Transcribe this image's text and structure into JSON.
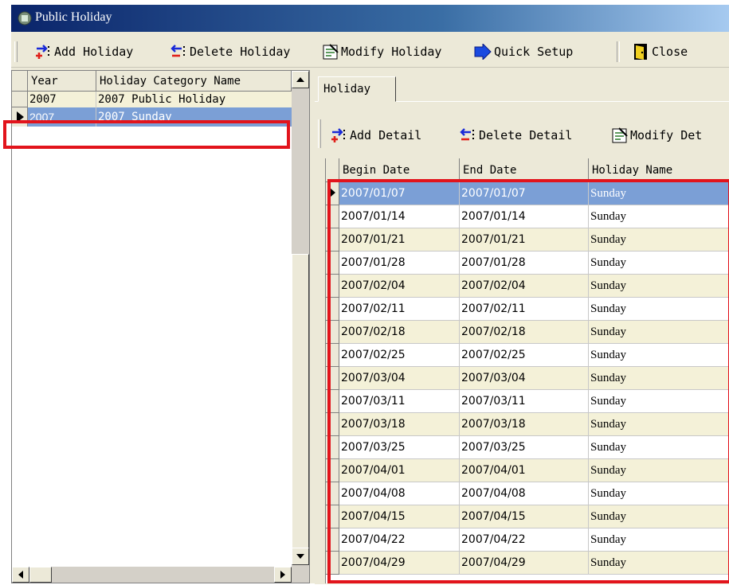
{
  "window": {
    "title": "Public Holiday",
    "icon": "app-icon"
  },
  "toolbar": {
    "add": "Add Holiday",
    "delete": "Delete Holiday",
    "modify": "Modify Holiday",
    "quick": "Quick Setup",
    "close": "Close"
  },
  "left_grid": {
    "headers": {
      "year": "Year",
      "category": "Holiday Category Name"
    },
    "rows": [
      {
        "year": "2007",
        "category": "2007 Public Holiday",
        "selected": false
      },
      {
        "year": "2007",
        "category": "2007 Sunday",
        "selected": true
      }
    ]
  },
  "tab": {
    "label": "Holiday"
  },
  "detail_toolbar": {
    "add": "Add Detail",
    "delete": "Delete Detail",
    "modify": "Modify Det"
  },
  "detail_grid": {
    "headers": {
      "begin": "Begin Date",
      "end": "End Date",
      "name": "Holiday Name"
    },
    "rows": [
      {
        "begin": "2007/01/07",
        "end": "2007/01/07",
        "name": "Sunday"
      },
      {
        "begin": "2007/01/14",
        "end": "2007/01/14",
        "name": "Sunday"
      },
      {
        "begin": "2007/01/21",
        "end": "2007/01/21",
        "name": "Sunday"
      },
      {
        "begin": "2007/01/28",
        "end": "2007/01/28",
        "name": "Sunday"
      },
      {
        "begin": "2007/02/04",
        "end": "2007/02/04",
        "name": "Sunday"
      },
      {
        "begin": "2007/02/11",
        "end": "2007/02/11",
        "name": "Sunday"
      },
      {
        "begin": "2007/02/18",
        "end": "2007/02/18",
        "name": "Sunday"
      },
      {
        "begin": "2007/02/25",
        "end": "2007/02/25",
        "name": "Sunday"
      },
      {
        "begin": "2007/03/04",
        "end": "2007/03/04",
        "name": "Sunday"
      },
      {
        "begin": "2007/03/11",
        "end": "2007/03/11",
        "name": "Sunday"
      },
      {
        "begin": "2007/03/18",
        "end": "2007/03/18",
        "name": "Sunday"
      },
      {
        "begin": "2007/03/25",
        "end": "2007/03/25",
        "name": "Sunday"
      },
      {
        "begin": "2007/04/01",
        "end": "2007/04/01",
        "name": "Sunday"
      },
      {
        "begin": "2007/04/08",
        "end": "2007/04/08",
        "name": "Sunday"
      },
      {
        "begin": "2007/04/15",
        "end": "2007/04/15",
        "name": "Sunday"
      },
      {
        "begin": "2007/04/22",
        "end": "2007/04/22",
        "name": "Sunday"
      },
      {
        "begin": "2007/04/29",
        "end": "2007/04/29",
        "name": "Sunday"
      }
    ]
  },
  "colors": {
    "selected_row": "#7b9fd6",
    "row_band": "#f4f1d8",
    "highlight_box": "#e2141c"
  }
}
